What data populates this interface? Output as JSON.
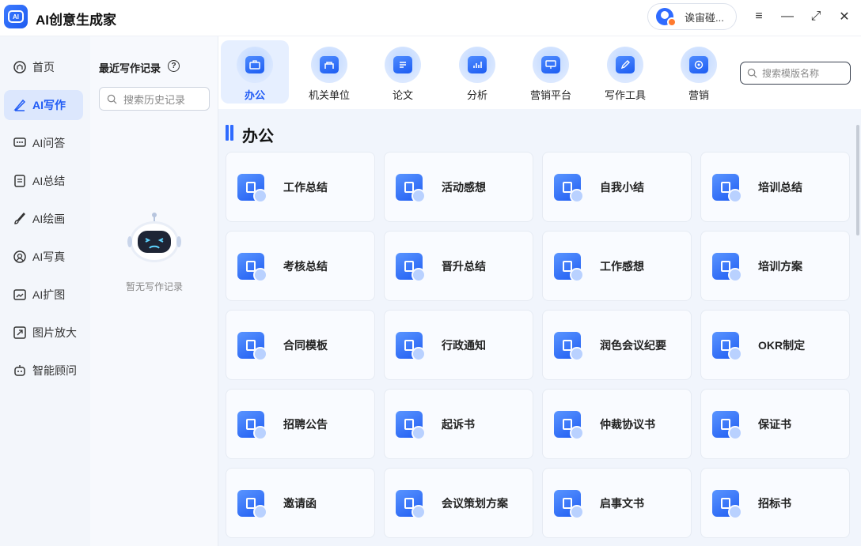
{
  "app": {
    "title": "AI创意生成家",
    "logo_text": "AI"
  },
  "user": {
    "name": "诶宙碰..."
  },
  "window_controls": {
    "menu": "≡",
    "minimize": "—",
    "maximize": "⤢",
    "close": "✕"
  },
  "sidebar": {
    "items": [
      {
        "label": "首页",
        "icon": "home-icon"
      },
      {
        "label": "AI写作",
        "icon": "pen-icon",
        "active": true
      },
      {
        "label": "AI问答",
        "icon": "chat-icon"
      },
      {
        "label": "AI总结",
        "icon": "document-icon"
      },
      {
        "label": "AI绘画",
        "icon": "brush-icon"
      },
      {
        "label": "AI写真",
        "icon": "portrait-icon"
      },
      {
        "label": "AI扩图",
        "icon": "expand-image-icon"
      },
      {
        "label": "图片放大",
        "icon": "enlarge-icon"
      },
      {
        "label": "智能顾问",
        "icon": "robot-icon"
      }
    ]
  },
  "history": {
    "title": "最近写作记录",
    "search_placeholder": "搜索历史记录",
    "empty_text": "暂无写作记录"
  },
  "categories": [
    {
      "label": "办公",
      "icon": "briefcase-icon",
      "active": true
    },
    {
      "label": "机关单位",
      "icon": "building-icon"
    },
    {
      "label": "论文",
      "icon": "paper-icon"
    },
    {
      "label": "分析",
      "icon": "analytics-icon"
    },
    {
      "label": "营销平台",
      "icon": "billboard-icon"
    },
    {
      "label": "写作工具",
      "icon": "edit-icon"
    },
    {
      "label": "营销",
      "icon": "target-icon"
    }
  ],
  "template_search": {
    "placeholder": "搜索模版名称"
  },
  "section": {
    "title": "办公"
  },
  "templates": [
    "工作总结",
    "活动感想",
    "自我小结",
    "培训总结",
    "考核总结",
    "晋升总结",
    "工作感想",
    "培训方案",
    "合同模板",
    "行政通知",
    "润色会议纪要",
    "OKR制定",
    "招聘公告",
    "起诉书",
    "仲裁协议书",
    "保证书",
    "邀请函",
    "会议策划方案",
    "启事文书",
    "招标书"
  ]
}
